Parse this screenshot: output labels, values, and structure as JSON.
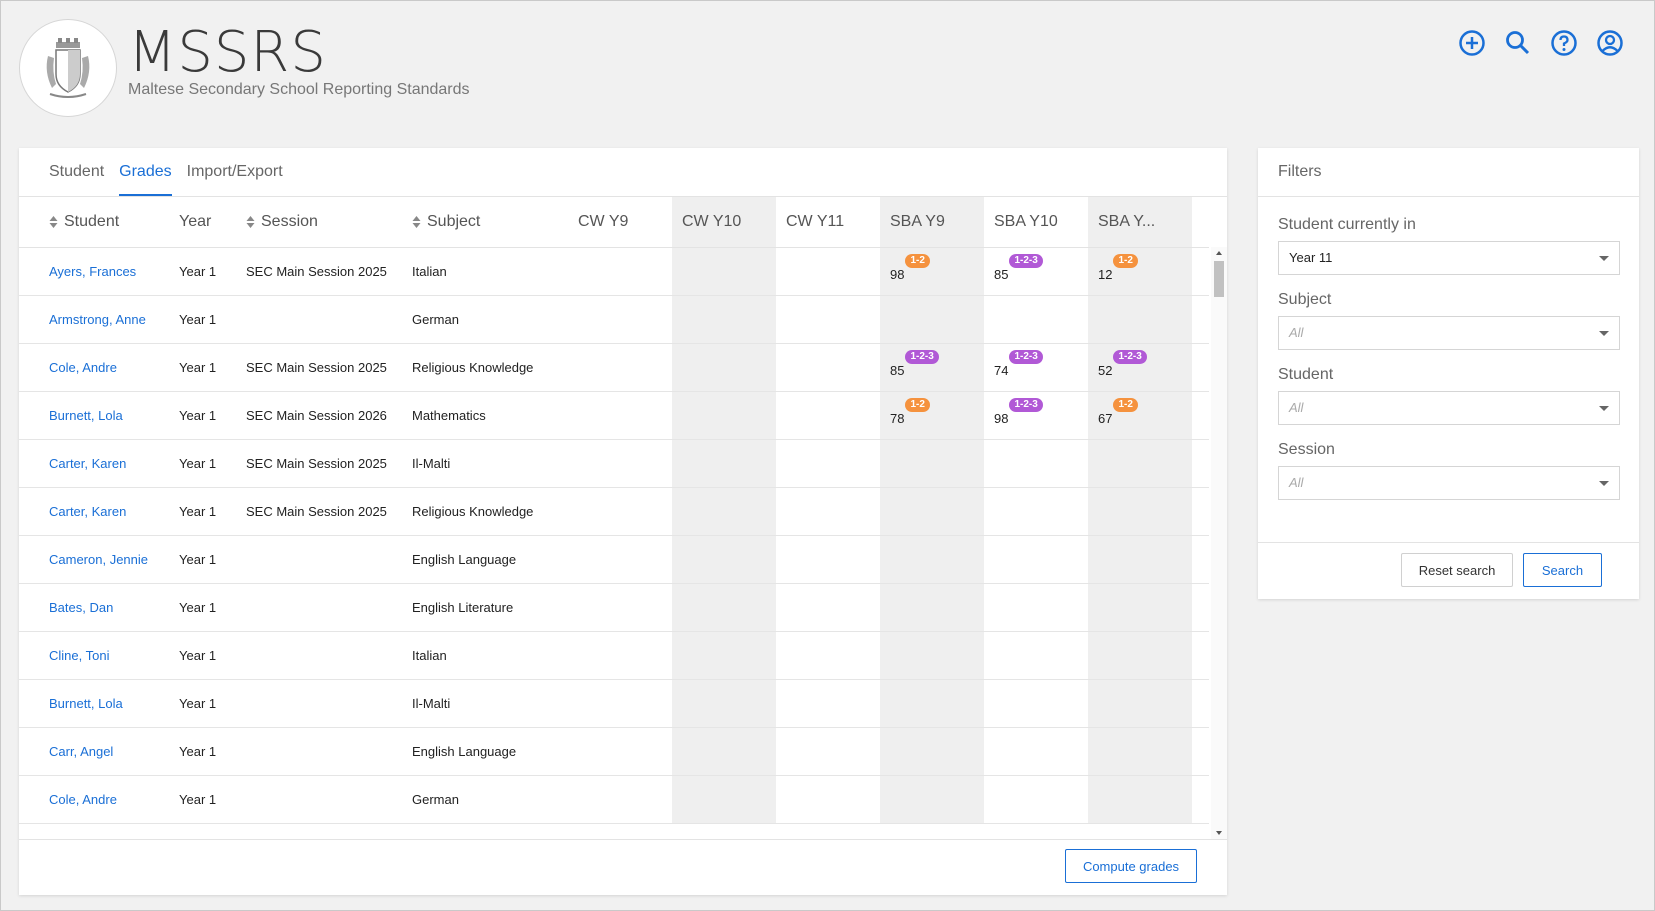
{
  "app": {
    "title": "MSSRS",
    "subtitle": "Maltese Secondary School Reporting Standards"
  },
  "header_icons": [
    "add-circle-icon",
    "search-icon",
    "help-icon",
    "account-icon"
  ],
  "tabs": [
    {
      "label": "Student",
      "active": false
    },
    {
      "label": "Grades",
      "active": true
    },
    {
      "label": "Import/Export",
      "active": false
    }
  ],
  "columns": [
    "Student",
    "Year",
    "Session",
    "Subject",
    "CW Y9",
    "CW Y10",
    "CW Y11",
    "SBA Y9",
    "SBA Y10",
    "SBA Y..."
  ],
  "rows": [
    {
      "student": "Ayers, Frances",
      "year": "Year 1",
      "session": "SEC Main Session 2025",
      "subject": "Italian",
      "sba_y9": "98",
      "sba_y9_badge": "1-2",
      "sba_y10": "85",
      "sba_y10_badge": "1-2-3",
      "sba_y11": "12",
      "sba_y11_badge": "1-2"
    },
    {
      "student": "Armstrong, Anne",
      "year": "Year 1",
      "session": "",
      "subject": "German"
    },
    {
      "student": "Cole, Andre",
      "year": "Year 1",
      "session": "SEC Main Session 2025",
      "subject": "Religious Knowledge",
      "sba_y9": "85",
      "sba_y9_badge": "1-2-3",
      "sba_y10": "74",
      "sba_y10_badge": "1-2-3",
      "sba_y11": "52",
      "sba_y11_badge": "1-2-3"
    },
    {
      "student": "Burnett, Lola",
      "year": "Year 1",
      "session": "SEC Main Session 2026",
      "subject": "Mathematics",
      "sba_y9": "78",
      "sba_y9_badge": "1-2",
      "sba_y10": "98",
      "sba_y10_badge": "1-2-3",
      "sba_y11": "67",
      "sba_y11_badge": "1-2"
    },
    {
      "student": "Carter, Karen",
      "year": "Year 1",
      "session": "SEC Main Session 2025",
      "subject": "Il-Malti"
    },
    {
      "student": "Carter, Karen",
      "year": "Year 1",
      "session": "SEC Main Session 2025",
      "subject": "Religious Knowledge"
    },
    {
      "student": "Cameron, Jennie",
      "year": "Year 1",
      "session": "",
      "subject": "English Language"
    },
    {
      "student": "Bates, Dan",
      "year": "Year 1",
      "session": "",
      "subject": "English Literature"
    },
    {
      "student": "Cline, Toni",
      "year": "Year 1",
      "session": "",
      "subject": "Italian"
    },
    {
      "student": "Burnett, Lola",
      "year": "Year 1",
      "session": "",
      "subject": "Il-Malti"
    },
    {
      "student": "Carr, Angel",
      "year": "Year 1",
      "session": "",
      "subject": "English Language"
    },
    {
      "student": "Cole, Andre",
      "year": "Year 1",
      "session": "",
      "subject": "German"
    }
  ],
  "badge_colors": {
    "1-2": "#f5923e",
    "1-2-3": "#b159d6"
  },
  "footer": {
    "compute_label": "Compute grades"
  },
  "filters": {
    "title": "Filters",
    "student_currently_in": {
      "label": "Student currently in",
      "value": "Year 11"
    },
    "subject": {
      "label": "Subject",
      "placeholder": "All"
    },
    "student": {
      "label": "Student",
      "placeholder": "All"
    },
    "session": {
      "label": "Session",
      "placeholder": "All"
    },
    "reset_label": "Reset search",
    "search_label": "Search"
  },
  "colors": {
    "accent": "#1a6fd6",
    "shaded_column": "#efefef"
  }
}
